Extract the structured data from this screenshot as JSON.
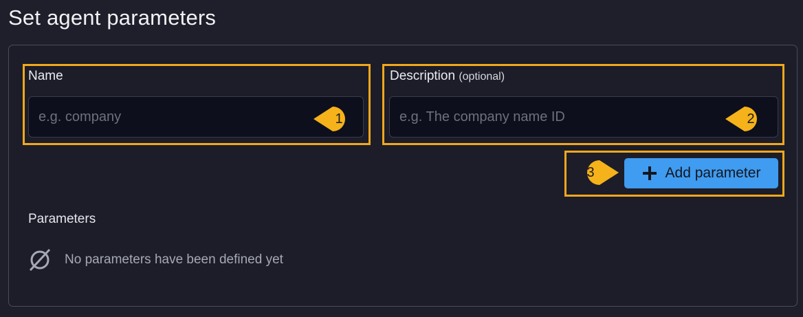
{
  "page": {
    "title": "Set agent parameters"
  },
  "form": {
    "name": {
      "label": "Name",
      "placeholder": "e.g. company",
      "value": ""
    },
    "description": {
      "label": "Description",
      "optional_label": "(optional)",
      "placeholder": "e.g. The company name ID",
      "value": ""
    },
    "add_button": {
      "label": "Add parameter",
      "icon": "plus-icon"
    }
  },
  "callouts": [
    "1",
    "2",
    "3"
  ],
  "parameters": {
    "title": "Parameters",
    "empty_icon": "empty-set-icon",
    "empty_text": "No parameters have been defined yet"
  },
  "colors": {
    "background": "#1e1f2b",
    "input_background": "#0e0f1c",
    "highlight": "#f2a81c",
    "callout": "#f5b21a",
    "accent_button": "#3f9cf0"
  }
}
